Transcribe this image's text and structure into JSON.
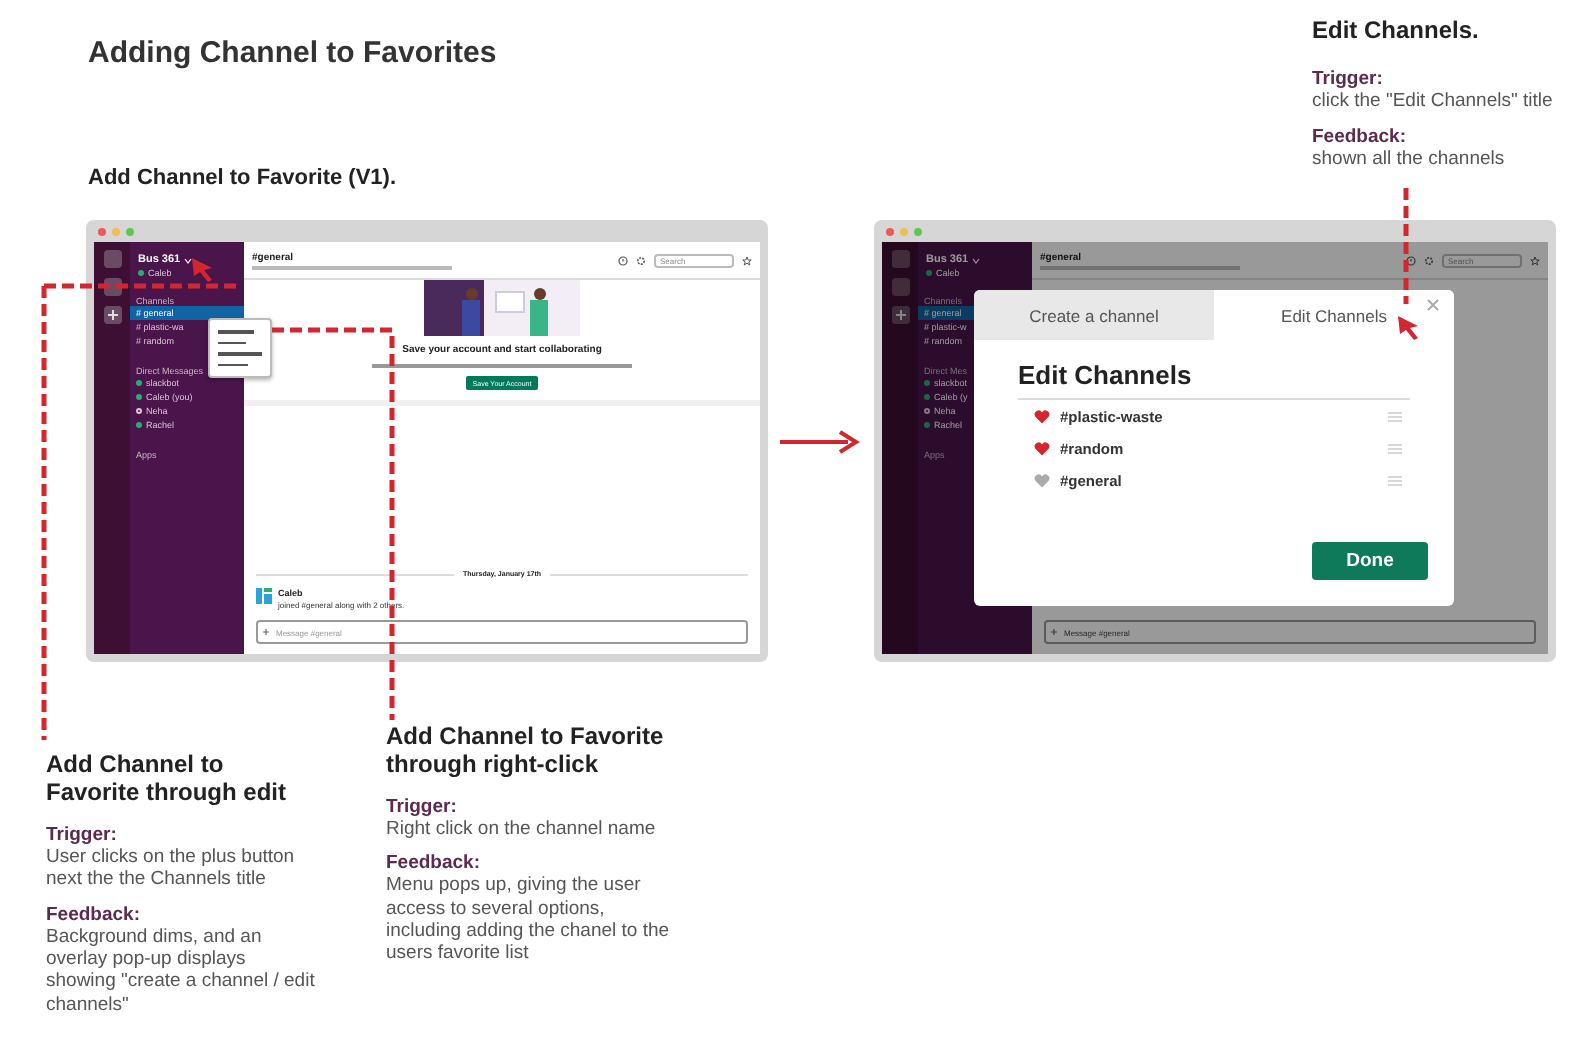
{
  "title": "Adding Channel to Favorites",
  "subtitle": "Add Channel to Favorite (V1).",
  "screens": [
    {
      "kind": "chat",
      "workspace": "Bus 361",
      "user": "Caleb",
      "channels_label": "Channels",
      "channels": [
        {
          "name": "# general",
          "selected": true
        },
        {
          "name": "# plastic-wa",
          "selected": false
        },
        {
          "name": "# random",
          "selected": false
        }
      ],
      "dm_label": "Direct Messages",
      "dms": [
        {
          "name": "slackbot",
          "online": true
        },
        {
          "name": "Caleb (you)",
          "online": true
        },
        {
          "name": "Neha",
          "online": false
        },
        {
          "name": "Rachel",
          "online": true
        }
      ],
      "apps_label": "Apps",
      "channel": "#general",
      "search_placeholder": "Search",
      "context_menu_open": true,
      "banner": {
        "title": "Save your account and start collaborating",
        "button": "Save Your Account"
      },
      "date": "Thursday, January 17th",
      "message": {
        "author": "Caleb",
        "text": "joined #general along with 2 others."
      },
      "composer_placeholder": "Message #general"
    },
    {
      "kind": "modal",
      "workspace": "Bus 361",
      "user": "Caleb",
      "channels_label": "Channels",
      "channels": [
        {
          "name": "# general",
          "selected": true
        },
        {
          "name": "# plastic-w",
          "selected": false
        },
        {
          "name": "# random",
          "selected": false
        }
      ],
      "dm_label": "Direct Mes",
      "dms": [
        {
          "name": "slackbot",
          "online": true
        },
        {
          "name": "Caleb (y",
          "online": true
        },
        {
          "name": "Neha",
          "online": false
        },
        {
          "name": "Rachel",
          "online": true
        }
      ],
      "apps_label": "Apps",
      "channel": "#general",
      "search_placeholder": "Search",
      "context_menu_open": false,
      "composer_placeholder": "Message #general",
      "modal": {
        "tabs": [
          {
            "label": "Create a channel",
            "selected": false
          },
          {
            "label": "Edit Channels",
            "selected": true
          }
        ],
        "heading": "Edit Channels",
        "channels": [
          {
            "name": "#plastic-waste",
            "favorite": true
          },
          {
            "name": "#random",
            "favorite": true
          },
          {
            "name": "#general",
            "favorite": false
          }
        ],
        "done": "Done"
      }
    }
  ],
  "annotations": [
    {
      "heading": "Add Channel to Favorite through edit",
      "trigger_label": "Trigger:",
      "trigger": "User clicks on the plus button next the the Channels title",
      "feedback_label": "Feedback:",
      "feedback": "Background dims, and an overlay pop-up displays showing \"create a channel / edit channels\""
    },
    {
      "heading": "Add Channel to Favorite through right-click",
      "trigger_label": "Trigger:",
      "trigger": "Right click on the channel name",
      "feedback_label": "Feedback:",
      "feedback": "Menu pops up, giving the user access to several options, including adding the chanel to the users favorite list"
    },
    {
      "heading": "Edit Channels.",
      "trigger_label": "Trigger:",
      "trigger": "click the \"Edit Channels\" title",
      "feedback_label": "Feedback:",
      "feedback": "shown all the channels"
    }
  ]
}
